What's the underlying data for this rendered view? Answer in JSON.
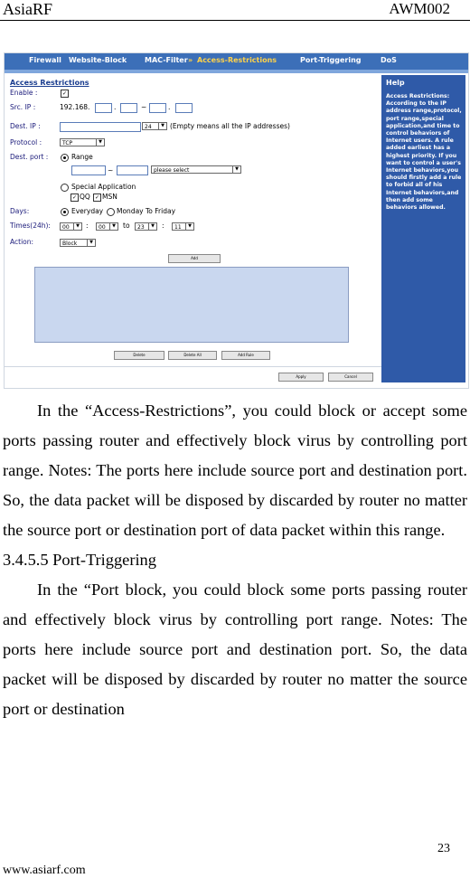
{
  "header": {
    "left": "AsiaRF",
    "right": "AWM002"
  },
  "screenshot": {
    "nav_tabs": [
      "Firewall",
      "Website-Block",
      "MAC-Filter",
      "Access-Restrictions",
      "Port-Triggering",
      "DoS"
    ],
    "nav_separator": "»",
    "section_title": "Access Restrictions",
    "labels": {
      "enable": "Enable :",
      "src_ip": "Src. IP :",
      "dest_ip": "Dest. IP :",
      "protocol": "Protocol :",
      "dest_port": "Dest. port :",
      "days": "Days:",
      "times": "Times(24h):",
      "action": "Action:"
    },
    "src_ip_prefix": "192.168.",
    "src_ip_dot": ".",
    "src_ip_tilde": "~",
    "dest_ip_mask": "24",
    "dest_ip_note": "(Empty means all the IP addresses)",
    "protocol_value": "TCP",
    "range_label": "Range",
    "range_tilde": "~",
    "port_select": "please select",
    "special_app_label": "Special Application",
    "qq_label": "QQ",
    "msn_label": "MSN",
    "everyday_label": "Everyday",
    "mon_fri_label": "Monday To Friday",
    "time_values": [
      "00",
      "00",
      "23",
      "11"
    ],
    "time_colon": ":",
    "time_to": "to",
    "action_value": "Block",
    "add_button": "Add",
    "list_buttons": [
      "Delete",
      "Delete All",
      "Add Rule"
    ],
    "bottom_buttons": [
      "Apply",
      "Cancel"
    ],
    "help_title": "Help",
    "help_text": "Access Restrictions: According to the IP address range,protocol, port range,special application,and time to control behaviors of Internet users. A rule added earliest has a highest priority. If you want to control a user's Internet behaviors,you should firstly add a rule to forbid all of his Internet behaviors,and then add some behaviors allowed."
  },
  "body": {
    "para1": "In the “Access-Restrictions”, you could block or accept some ports passing router and effectively block virus by controlling port range. Notes: The ports here include source port and destination port. So, the data packet will be disposed by discarded by router no matter the source port or destination port of data packet within this range.",
    "heading": "3.4.5.5 Port-Triggering",
    "para2": "In the “Port block, you could block some ports passing router and effectively block virus by controlling port range. Notes: The ports here include source port and destination port. So, the data packet will be disposed by discarded by router no matter the source port or destination"
  },
  "footer": {
    "page_number": "23",
    "website": "www.asiarf.com"
  }
}
